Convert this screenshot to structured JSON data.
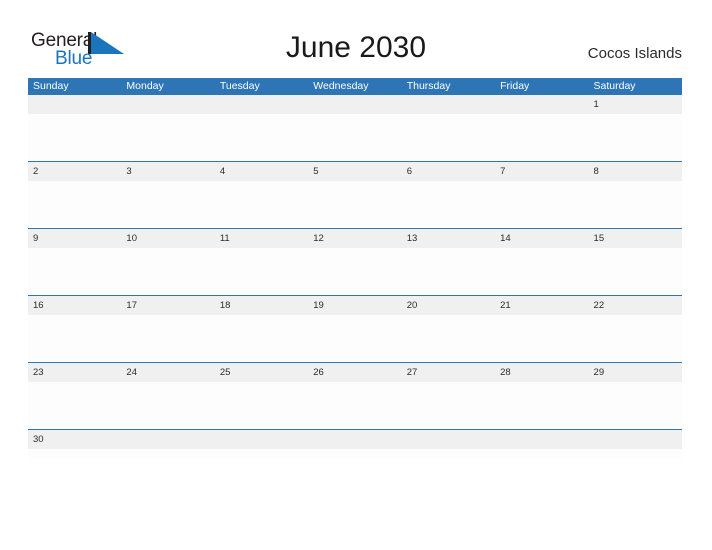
{
  "brand": {
    "name_primary": "General",
    "name_secondary": "Blue",
    "flag_icon": "blue-flag-triangle-icon",
    "primary_color": "#231f20",
    "secondary_color": "#1b75bc"
  },
  "header": {
    "title": "June 2030",
    "locale": "Cocos Islands"
  },
  "theme": {
    "header_blue": "#2e75b6",
    "date_band_gray": "#f0f0f0",
    "row_divider": "#2e75b6",
    "page_background": "#ffffff"
  },
  "calendar": {
    "month": "June",
    "year": "2030",
    "weekdays": [
      "Sunday",
      "Monday",
      "Tuesday",
      "Wednesday",
      "Thursday",
      "Friday",
      "Saturday"
    ],
    "weeks": [
      {
        "days": [
          "",
          "",
          "",
          "",
          "",
          "",
          "1"
        ]
      },
      {
        "days": [
          "2",
          "3",
          "4",
          "5",
          "6",
          "7",
          "8"
        ]
      },
      {
        "days": [
          "9",
          "10",
          "11",
          "12",
          "13",
          "14",
          "15"
        ]
      },
      {
        "days": [
          "16",
          "17",
          "18",
          "19",
          "20",
          "21",
          "22"
        ]
      },
      {
        "days": [
          "23",
          "24",
          "25",
          "26",
          "27",
          "28",
          "29"
        ]
      },
      {
        "days": [
          "30",
          "",
          "",
          "",
          "",
          "",
          ""
        ]
      }
    ]
  }
}
